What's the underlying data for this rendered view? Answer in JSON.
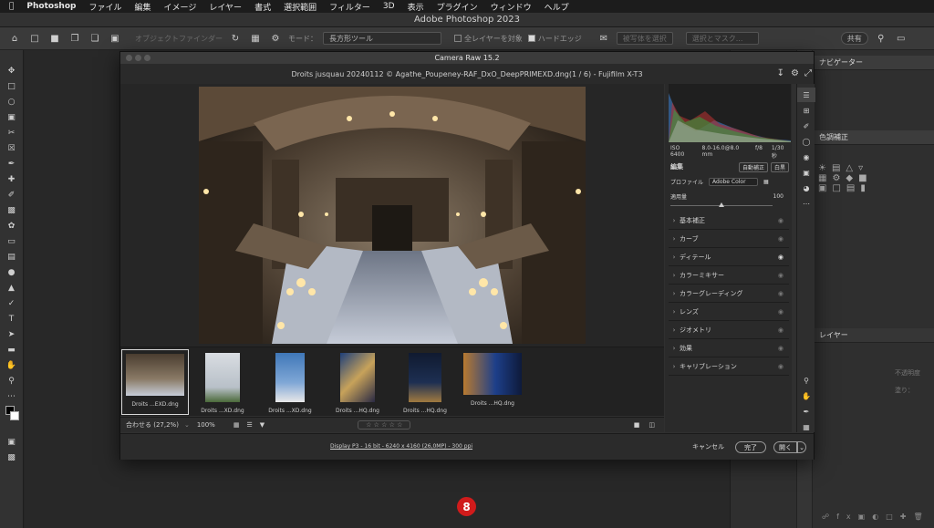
{
  "menubar": {
    "apple": "",
    "items": [
      "Photoshop",
      "ファイル",
      "編集",
      "イメージ",
      "レイヤー",
      "書式",
      "選択範囲",
      "フィルター",
      "3D",
      "表示",
      "プラグイン",
      "ウィンドウ",
      "ヘルプ"
    ]
  },
  "window_title": "Adobe Photoshop 2023",
  "options_bar": {
    "object_finder": "オブジェクトファインダー",
    "mode_label": "モード：",
    "mode_value": "長方形ツール",
    "all_layers": "全レイヤーを対象",
    "hard_edge": "ハードエッジ",
    "select_subject": "被写体を選択",
    "select_mask": "選択とマスク...",
    "share": "共有"
  },
  "panels": {
    "navigator_tab": "ナビゲーター",
    "adjust_tab": "色調補正",
    "layers_tab": "レイヤー",
    "opacity_label": "不透明度",
    "fill_label": "塗り："
  },
  "camera_raw": {
    "title": "Camera Raw 15.2",
    "file_title": "Droits jusquau 20240112 © Agathe_Poupeney-RAF_DxO_DeepPRIMEXD.dng(1 / 6)  -  Fujifilm X-T3",
    "exif": {
      "iso": "ISO 6400",
      "lens": "8.0-16.0@8.0 mm",
      "fstop": "f/8",
      "shutter": "1/30 秒"
    },
    "edit_label": "編集",
    "auto_label": "自動補正",
    "bw_label": "白黒",
    "profile_label": "プロファイル",
    "profile_value": "Adobe Color",
    "amount_label": "適用量",
    "amount_value": "100",
    "amount_fraction": 0.5,
    "sections": [
      "基本補正",
      "カーブ",
      "ディテール",
      "カラーミキサー",
      "カラーグレーディング",
      "レンズ",
      "ジオメトリ",
      "効果",
      "キャリブレーション"
    ],
    "thumbnails": [
      {
        "caption": "Droits ...EXD.dng",
        "selected": true
      },
      {
        "caption": "Droits ...XD.dng",
        "selected": false
      },
      {
        "caption": "Droits ...XD.dng",
        "selected": false
      },
      {
        "caption": "Droits ...HQ.dng",
        "selected": false
      },
      {
        "caption": "Droits ...HQ.dng",
        "selected": false
      },
      {
        "caption": "Droits ...HQ.dng",
        "selected": false
      }
    ],
    "zoom_fit": "合わせる (27,2%)",
    "zoom_pct": "100%",
    "stars": "☆ ☆ ☆ ☆ ☆",
    "footer_info": "Display P3 - 16 bit - 6240 x 4160 (26,0MP) - 300 ppi",
    "cancel": "キャンセル",
    "done": "完了",
    "open": "開く"
  },
  "step_badge": "8",
  "colors": {
    "accent_red": "#d01b1b",
    "bg": "#262626"
  }
}
